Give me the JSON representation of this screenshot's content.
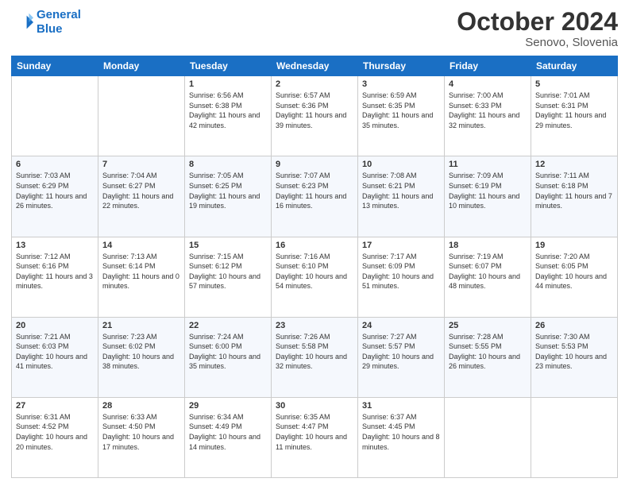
{
  "logo": {
    "line1": "General",
    "line2": "Blue"
  },
  "header": {
    "month": "October 2024",
    "location": "Senovo, Slovenia"
  },
  "weekdays": [
    "Sunday",
    "Monday",
    "Tuesday",
    "Wednesday",
    "Thursday",
    "Friday",
    "Saturday"
  ],
  "weeks": [
    [
      {
        "day": "",
        "info": ""
      },
      {
        "day": "",
        "info": ""
      },
      {
        "day": "1",
        "info": "Sunrise: 6:56 AM\nSunset: 6:38 PM\nDaylight: 11 hours and 42 minutes."
      },
      {
        "day": "2",
        "info": "Sunrise: 6:57 AM\nSunset: 6:36 PM\nDaylight: 11 hours and 39 minutes."
      },
      {
        "day": "3",
        "info": "Sunrise: 6:59 AM\nSunset: 6:35 PM\nDaylight: 11 hours and 35 minutes."
      },
      {
        "day": "4",
        "info": "Sunrise: 7:00 AM\nSunset: 6:33 PM\nDaylight: 11 hours and 32 minutes."
      },
      {
        "day": "5",
        "info": "Sunrise: 7:01 AM\nSunset: 6:31 PM\nDaylight: 11 hours and 29 minutes."
      }
    ],
    [
      {
        "day": "6",
        "info": "Sunrise: 7:03 AM\nSunset: 6:29 PM\nDaylight: 11 hours and 26 minutes."
      },
      {
        "day": "7",
        "info": "Sunrise: 7:04 AM\nSunset: 6:27 PM\nDaylight: 11 hours and 22 minutes."
      },
      {
        "day": "8",
        "info": "Sunrise: 7:05 AM\nSunset: 6:25 PM\nDaylight: 11 hours and 19 minutes."
      },
      {
        "day": "9",
        "info": "Sunrise: 7:07 AM\nSunset: 6:23 PM\nDaylight: 11 hours and 16 minutes."
      },
      {
        "day": "10",
        "info": "Sunrise: 7:08 AM\nSunset: 6:21 PM\nDaylight: 11 hours and 13 minutes."
      },
      {
        "day": "11",
        "info": "Sunrise: 7:09 AM\nSunset: 6:19 PM\nDaylight: 11 hours and 10 minutes."
      },
      {
        "day": "12",
        "info": "Sunrise: 7:11 AM\nSunset: 6:18 PM\nDaylight: 11 hours and 7 minutes."
      }
    ],
    [
      {
        "day": "13",
        "info": "Sunrise: 7:12 AM\nSunset: 6:16 PM\nDaylight: 11 hours and 3 minutes."
      },
      {
        "day": "14",
        "info": "Sunrise: 7:13 AM\nSunset: 6:14 PM\nDaylight: 11 hours and 0 minutes."
      },
      {
        "day": "15",
        "info": "Sunrise: 7:15 AM\nSunset: 6:12 PM\nDaylight: 10 hours and 57 minutes."
      },
      {
        "day": "16",
        "info": "Sunrise: 7:16 AM\nSunset: 6:10 PM\nDaylight: 10 hours and 54 minutes."
      },
      {
        "day": "17",
        "info": "Sunrise: 7:17 AM\nSunset: 6:09 PM\nDaylight: 10 hours and 51 minutes."
      },
      {
        "day": "18",
        "info": "Sunrise: 7:19 AM\nSunset: 6:07 PM\nDaylight: 10 hours and 48 minutes."
      },
      {
        "day": "19",
        "info": "Sunrise: 7:20 AM\nSunset: 6:05 PM\nDaylight: 10 hours and 44 minutes."
      }
    ],
    [
      {
        "day": "20",
        "info": "Sunrise: 7:21 AM\nSunset: 6:03 PM\nDaylight: 10 hours and 41 minutes."
      },
      {
        "day": "21",
        "info": "Sunrise: 7:23 AM\nSunset: 6:02 PM\nDaylight: 10 hours and 38 minutes."
      },
      {
        "day": "22",
        "info": "Sunrise: 7:24 AM\nSunset: 6:00 PM\nDaylight: 10 hours and 35 minutes."
      },
      {
        "day": "23",
        "info": "Sunrise: 7:26 AM\nSunset: 5:58 PM\nDaylight: 10 hours and 32 minutes."
      },
      {
        "day": "24",
        "info": "Sunrise: 7:27 AM\nSunset: 5:57 PM\nDaylight: 10 hours and 29 minutes."
      },
      {
        "day": "25",
        "info": "Sunrise: 7:28 AM\nSunset: 5:55 PM\nDaylight: 10 hours and 26 minutes."
      },
      {
        "day": "26",
        "info": "Sunrise: 7:30 AM\nSunset: 5:53 PM\nDaylight: 10 hours and 23 minutes."
      }
    ],
    [
      {
        "day": "27",
        "info": "Sunrise: 6:31 AM\nSunset: 4:52 PM\nDaylight: 10 hours and 20 minutes."
      },
      {
        "day": "28",
        "info": "Sunrise: 6:33 AM\nSunset: 4:50 PM\nDaylight: 10 hours and 17 minutes."
      },
      {
        "day": "29",
        "info": "Sunrise: 6:34 AM\nSunset: 4:49 PM\nDaylight: 10 hours and 14 minutes."
      },
      {
        "day": "30",
        "info": "Sunrise: 6:35 AM\nSunset: 4:47 PM\nDaylight: 10 hours and 11 minutes."
      },
      {
        "day": "31",
        "info": "Sunrise: 6:37 AM\nSunset: 4:45 PM\nDaylight: 10 hours and 8 minutes."
      },
      {
        "day": "",
        "info": ""
      },
      {
        "day": "",
        "info": ""
      }
    ]
  ]
}
